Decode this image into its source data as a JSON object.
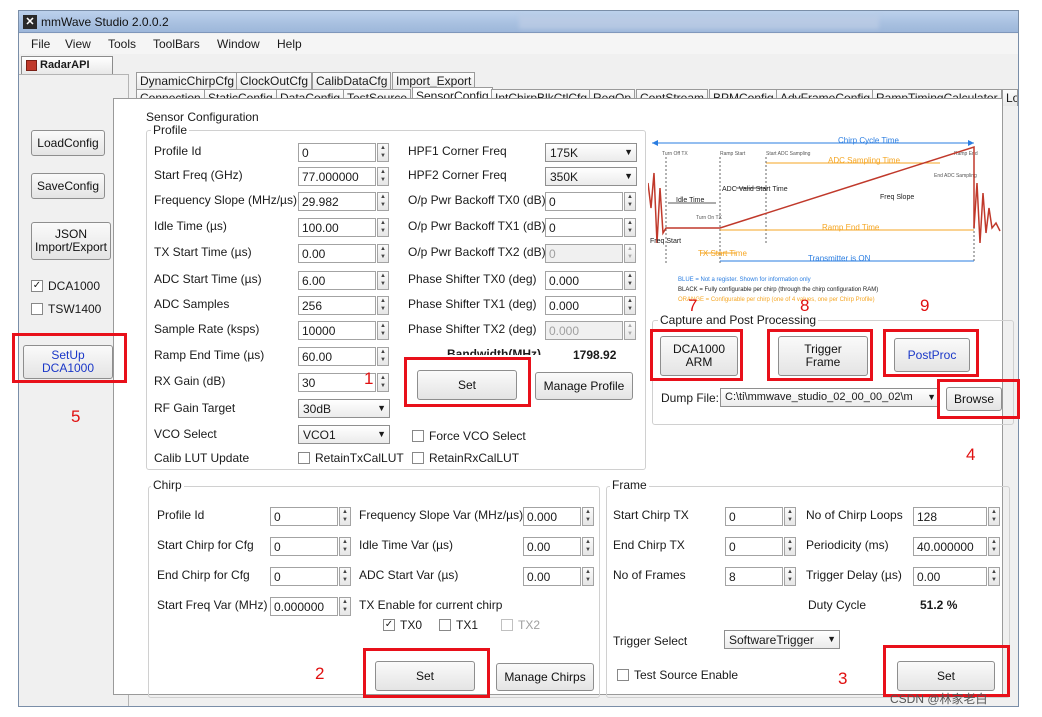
{
  "window": {
    "title": "mmWave Studio 2.0.0.2"
  },
  "menu": [
    "File",
    "View",
    "Tools",
    "ToolBars",
    "Window",
    "Help"
  ],
  "api_tab": "RadarAPI",
  "left_panel": {
    "load_config": "LoadConfig",
    "save_config": "SaveConfig",
    "json_line1": "JSON",
    "json_line2": "Import/Export",
    "dca1000_label": "DCA1000",
    "dca1000_checked": true,
    "tsw1400_label": "TSW1400",
    "tsw1400_checked": false,
    "setup_line1": "SetUp",
    "setup_line2": "DCA1000"
  },
  "tabs_row1": [
    "DynamicChirpCfg",
    "ClockOutCfg",
    "CalibDataCfg",
    "Import_Export"
  ],
  "tabs_row2": [
    "Connection",
    "StaticConfig",
    "DataConfig",
    "TestSource",
    "SensorConfig",
    "IntChirpBlkCtlCfg",
    "RegOp",
    "ContStream",
    "BPMConfig",
    "AdvFrameConfig",
    "RampTimingCalculator",
    "Lo"
  ],
  "sensor_config": {
    "title": "Sensor Configuration",
    "profile": {
      "title": "Profile",
      "fields": [
        {
          "label": "Profile Id",
          "value": "0"
        },
        {
          "label": "Start Freq (GHz)",
          "value": "77.000000"
        },
        {
          "label": "Frequency Slope (MHz/µs)",
          "value": "29.982"
        },
        {
          "label": "Idle Time (µs)",
          "value": "100.00"
        },
        {
          "label": "TX Start Time (µs)",
          "value": "0.00"
        },
        {
          "label": "ADC Start Time (µs)",
          "value": "6.00"
        },
        {
          "label": "ADC Samples",
          "value": "256"
        },
        {
          "label": "Sample Rate (ksps)",
          "value": "10000"
        },
        {
          "label": "Ramp End Time (µs)",
          "value": "60.00"
        },
        {
          "label": "RX Gain (dB)",
          "value": "30"
        }
      ],
      "rf_gain_label": "RF Gain Target",
      "rf_gain_value": "30dB",
      "vco_label": "VCO Select",
      "vco_value": "VCO1",
      "calib_label": "Calib LUT Update",
      "retain_tx": "RetainTxCalLUT",
      "retain_rx": "RetainRxCalLUT",
      "force_vco": "Force VCO Select",
      "right_fields": [
        {
          "label": "HPF1 Corner Freq",
          "value": "175K",
          "type": "select"
        },
        {
          "label": "HPF2 Corner Freq",
          "value": "350K",
          "type": "select"
        },
        {
          "label": "O/p Pwr Backoff TX0 (dB)",
          "value": "0",
          "type": "spin"
        },
        {
          "label": "O/p Pwr Backoff TX1 (dB)",
          "value": "0",
          "type": "spin"
        },
        {
          "label": "O/p Pwr Backoff TX2 (dB)",
          "value": "0",
          "type": "spin",
          "disabled": true
        },
        {
          "label": "Phase Shifter TX0 (deg)",
          "value": "0.000",
          "type": "spin"
        },
        {
          "label": "Phase Shifter TX1 (deg)",
          "value": "0.000",
          "type": "spin"
        },
        {
          "label": "Phase Shifter TX2 (deg)",
          "value": "0.000",
          "type": "spin",
          "disabled": true
        }
      ],
      "bandwidth_label": "Bandwidth(MHz)",
      "bandwidth_value": "1798.92",
      "set_button": "Set",
      "manage_button": "Manage Profile"
    },
    "diagram": {
      "chirp_cycle": "Chirp Cycle Time",
      "adc_sampling": "ADC Sampling Time",
      "adc_valid": "ADC Valid Start Time",
      "freq_slope": "Freq Slope",
      "idle_time": "Idle Time",
      "freq_start": "Freq Start",
      "tx_start": "TX Start Time",
      "ramp_end": "Ramp End Time",
      "transmitter_on": "Transmitter is ON",
      "turn_off_tx": "Turn Off TX",
      "ramp_start": "Ramp Start",
      "start_adc": "Start ADC Sampling",
      "ramp_end_small": "Ramp End",
      "end_adc": "End ADC Sampling",
      "turn_on_tx": "Turn On TX",
      "note_blue": "BLUE = Not a register. Shown for information only",
      "note_black": "BLACK = Fully configurable per chirp (through the chirp configuration RAM)",
      "note_orange": "ORANGE = Configurable per chirp (one of 4 values, one per Chirp Profile)"
    },
    "capture": {
      "title": "Capture and Post Processing",
      "dca_arm1": "DCA1000",
      "dca_arm2": "ARM",
      "trigger1": "Trigger",
      "trigger2": "Frame",
      "postproc": "PostProc",
      "dump_label": "Dump File:",
      "dump_value": "C:\\ti\\mmwave_studio_02_00_00_02\\m",
      "browse": "Browse"
    },
    "chirp": {
      "title": "Chirp",
      "left_fields": [
        {
          "label": "Profile Id",
          "value": "0"
        },
        {
          "label": "Start Chirp for Cfg",
          "value": "0"
        },
        {
          "label": "End Chirp for Cfg",
          "value": "0"
        },
        {
          "label": "Start Freq Var (MHz)",
          "value": "0.000000"
        }
      ],
      "right_fields": [
        {
          "label": "Frequency Slope Var (MHz/µs)",
          "value": "0.000"
        },
        {
          "label": "Idle Time Var (µs)",
          "value": "0.00"
        },
        {
          "label": "ADC Start Var (µs)",
          "value": "0.00"
        }
      ],
      "tx_enable_label": "TX Enable for current chirp",
      "tx0": "TX0",
      "tx0_checked": true,
      "tx1": "TX1",
      "tx1_checked": false,
      "tx2": "TX2",
      "tx2_checked": false,
      "set_button": "Set",
      "manage_button": "Manage Chirps"
    },
    "frame": {
      "title": "Frame",
      "left_fields": [
        {
          "label": "Start Chirp TX",
          "value": "0"
        },
        {
          "label": "End Chirp TX",
          "value": "0"
        },
        {
          "label": "No of Frames",
          "value": "8"
        }
      ],
      "right_fields": [
        {
          "label": "No of Chirp Loops",
          "value": "128"
        },
        {
          "label": "Periodicity (ms)",
          "value": "40.000000"
        },
        {
          "label": "Trigger Delay (µs)",
          "value": "0.00"
        }
      ],
      "duty_label": "Duty Cycle",
      "duty_value": "51.2 %",
      "trigger_label": "Trigger Select",
      "trigger_value": "SoftwareTrigger",
      "test_source": "Test Source Enable",
      "set_button": "Set"
    }
  },
  "annotations": [
    "1",
    "2",
    "3",
    "4",
    "5",
    "7",
    "8",
    "9"
  ],
  "watermark": "CSDN @林家老白",
  "colors": {
    "annotation_red": "#e8101a",
    "diagram_orange": "#f5a623",
    "diagram_blue": "#2a7de1"
  }
}
